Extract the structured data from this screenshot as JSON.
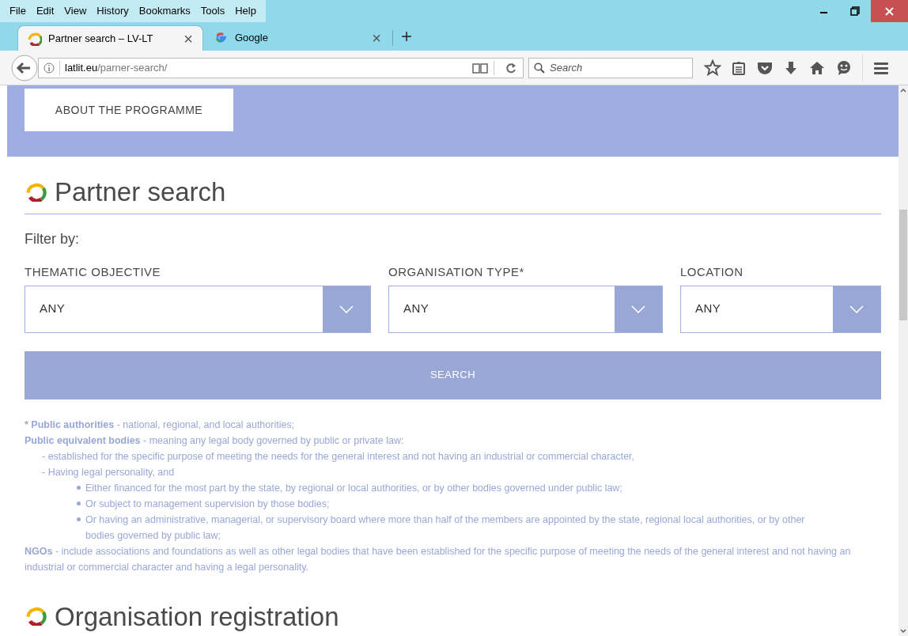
{
  "menu_bar": [
    "File",
    "Edit",
    "View",
    "History",
    "Bookmarks",
    "Tools",
    "Help"
  ],
  "tabs": [
    {
      "title": "Partner search – LV-LT",
      "close": "×",
      "selected": true,
      "kind": "site"
    },
    {
      "title": "Google",
      "close": "×",
      "selected": false,
      "kind": "google"
    }
  ],
  "new_tab": "+",
  "address_bar": {
    "domain": "latlit.eu",
    "path": "/parner-search/"
  },
  "search_field": {
    "placeholder": "Search"
  },
  "banner": {
    "button": "ABOUT THE PROGRAMME"
  },
  "heading": "Partner search",
  "filter_label": "Filter by:",
  "filters": [
    {
      "label": "THEMATIC OBJECTIVE",
      "value": "ANY"
    },
    {
      "label": "ORGANISATION TYPE*",
      "value": "ANY"
    },
    {
      "label": "LOCATION",
      "value": "ANY"
    }
  ],
  "search_button": "SEARCH",
  "notes": [
    {
      "kind": "term",
      "term": "* Public authorities",
      "text": " - national, regional, and local authorities;"
    },
    {
      "kind": "term",
      "term": "Public equivalent bodies",
      "text": " - meaning any legal body governed by public or private law:"
    },
    {
      "kind": "dash",
      "text": "- established for the specific purpose of meeting the needs for the general interest and not having an industrial or commercial character,"
    },
    {
      "kind": "dash",
      "text": "- Having legal personality, and"
    },
    {
      "kind": "bullet",
      "text": "Either financed for the most part by the state, by regional or local authorities, or by other bodies governed under public law;"
    },
    {
      "kind": "bullet",
      "text": "Or subject to management supervision by those bodies;"
    },
    {
      "kind": "bullet",
      "text": "Or having an administrative, managerial, or supervisory board where more than half of the members are appointed by the state, regional local authorities, or by other bodies governed by public law;"
    },
    {
      "kind": "term",
      "term": "NGOs",
      "text": " - include associations and foundations as well as other legal bodies that have been established for the specific purpose of meeting the needs of the general interest and not having an industrial or commercial character and having a legal personality."
    }
  ],
  "next_heading": "Organisation registration"
}
